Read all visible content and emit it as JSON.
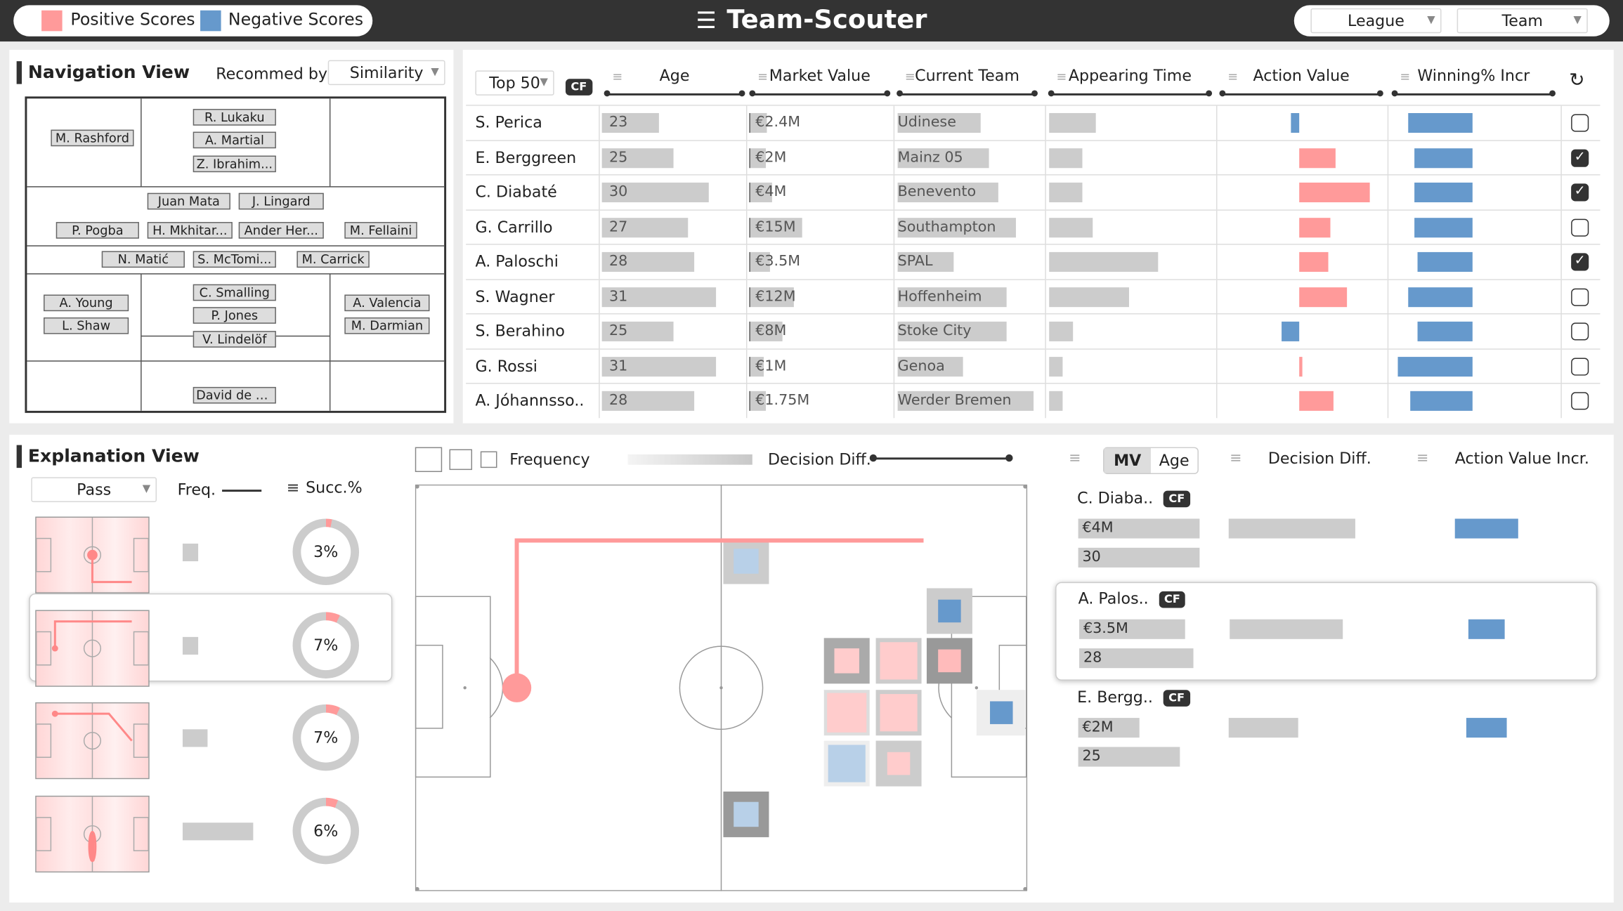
{
  "app": {
    "title": "Team-Scouter"
  },
  "legend": {
    "positive": "Positive Scores",
    "negative": "Negative Scores",
    "positive_color": "#ff9a9a",
    "negative_color": "#6699cc"
  },
  "top_filters": {
    "league": "League",
    "team": "Team"
  },
  "nav": {
    "title": "Navigation View",
    "recommend_label": "Recommed by:",
    "recommend_value": "Similarity",
    "players": [
      "M. Rashford",
      "R. Lukaku",
      "A. Martial",
      "Z. Ibrahim...",
      "Juan Mata",
      "J. Lingard",
      "P. Pogba",
      "H. Mkhitar...",
      "Ander Her...",
      "M. Fellaini",
      "N. Matić",
      "S. McTomi...",
      "M. Carrick",
      "A. Young",
      "L. Shaw",
      "C. Smalling",
      "P. Jones",
      "V. Lindelöf",
      "A. Valencia",
      "M. Darmian",
      "David de Gea"
    ]
  },
  "table": {
    "top_select": "Top 50",
    "cf": "CF",
    "headers": [
      "Age",
      "Market Value",
      "Current Team",
      "Appearing Time",
      "Action Value",
      "Winning% Incr"
    ],
    "rows": [
      {
        "name": "S. Perica",
        "age": "23",
        "mv": "€2.4M",
        "team": "Udinese",
        "checked": false,
        "age_v": 23,
        "mv_v": 2.4,
        "app_v": 0.35,
        "av_v": -0.08,
        "win_v": 0.62
      },
      {
        "name": "E. Berggreen",
        "age": "25",
        "mv": "€2M",
        "team": "Mainz 05",
        "checked": true,
        "age_v": 25,
        "mv_v": 2,
        "app_v": 0.25,
        "av_v": 0.35,
        "win_v": 0.56
      },
      {
        "name": "C. Diabaté",
        "age": "30",
        "mv": "€4M",
        "team": "Benevento",
        "checked": true,
        "age_v": 30,
        "mv_v": 4,
        "app_v": 0.25,
        "av_v": 0.68,
        "win_v": 0.56
      },
      {
        "name": "G. Carrillo",
        "age": "27",
        "mv": "€15M",
        "team": "Southampton",
        "checked": false,
        "age_v": 27,
        "mv_v": 15,
        "app_v": 0.33,
        "av_v": 0.3,
        "win_v": 0.56
      },
      {
        "name": "A. Paloschi",
        "age": "28",
        "mv": "€3.5M",
        "team": "SPAL",
        "checked": true,
        "age_v": 28,
        "mv_v": 3.5,
        "app_v": 0.82,
        "av_v": 0.28,
        "win_v": 0.53
      },
      {
        "name": "S. Wagner",
        "age": "31",
        "mv": "€12M",
        "team": "Hoffenheim",
        "checked": false,
        "age_v": 31,
        "mv_v": 12,
        "app_v": 0.6,
        "av_v": 0.46,
        "win_v": 0.62
      },
      {
        "name": "S. Berahino",
        "age": "25",
        "mv": "€8M",
        "team": "Stoke City",
        "checked": false,
        "age_v": 25,
        "mv_v": 8,
        "app_v": 0.18,
        "av_v": -0.17,
        "win_v": 0.53
      },
      {
        "name": "G. Rossi",
        "age": "31",
        "mv": "€1M",
        "team": "Genoa",
        "checked": false,
        "age_v": 31,
        "mv_v": 1,
        "app_v": 0.1,
        "av_v": 0.03,
        "win_v": 0.72
      },
      {
        "name": "A. Jóhannsso..",
        "age": "28",
        "mv": "€1.75M",
        "team": "Werder Bremen",
        "checked": false,
        "age_v": 28,
        "mv_v": 1.75,
        "app_v": 0.1,
        "av_v": 0.33,
        "win_v": 0.6
      }
    ]
  },
  "explain": {
    "title": "Explanation View",
    "action": "Pass",
    "freq": "Freq.",
    "succ": "Succ.%",
    "items": [
      {
        "pct": "3%",
        "val": 3,
        "freq": 0.15
      },
      {
        "pct": "7%",
        "val": 7,
        "freq": 0.14
      },
      {
        "pct": "7%",
        "val": 7,
        "freq": 0.24
      },
      {
        "pct": "6%",
        "val": 6,
        "freq": 0.68
      }
    ]
  },
  "pitch_legend": {
    "frequency": "Frequency",
    "decision": "Decision Diff."
  },
  "compare": {
    "tab_mv": "MV",
    "tab_age": "Age",
    "decision": "Decision Diff.",
    "action": "Action Value Incr.",
    "players": [
      {
        "name": "C. Diaba..",
        "cf": "CF",
        "mv": "€4M",
        "age": "30",
        "mv_w": 0.96,
        "age_w": 0.96,
        "dd_w": 0.7,
        "av_w": 0.55
      },
      {
        "name": "A. Palos..",
        "cf": "CF",
        "mv": "€3.5M",
        "age": "28",
        "mv_w": 0.84,
        "age_w": 0.9,
        "dd_w": 0.62,
        "av_w": 0.32
      },
      {
        "name": "E. Bergg..",
        "cf": "CF",
        "mv": "€2M",
        "age": "25",
        "mv_w": 0.48,
        "age_w": 0.8,
        "dd_w": 0.38,
        "av_w": 0.35
      }
    ]
  }
}
